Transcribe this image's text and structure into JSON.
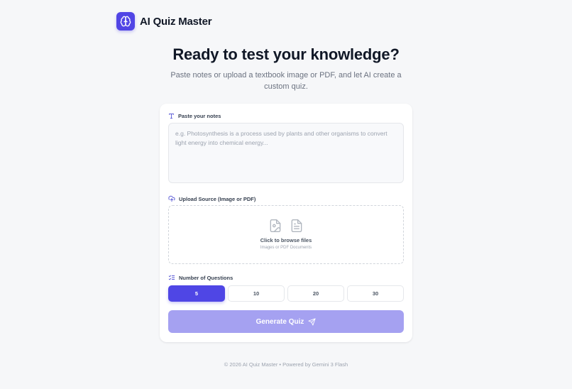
{
  "app": {
    "title": "AI Quiz Master",
    "brand_color": "#5145e5"
  },
  "hero": {
    "title": "Ready to test your knowledge?",
    "subtitle": "Paste notes or upload a textbook image or PDF, and let AI create a custom quiz."
  },
  "notes_section": {
    "label": "Paste your notes",
    "icon": "text-icon",
    "placeholder": "e.g. Photosynthesis is a process used by plants and other organisms to convert light energy into chemical energy...",
    "value": ""
  },
  "upload_section": {
    "label": "Upload Source (Image or PDF)",
    "icon": "cloud-upload-icon",
    "dropzone_title": "Click to browse files",
    "dropzone_subtitle": "Images or PDF Documents",
    "icons": [
      "image-file-icon",
      "document-file-icon"
    ]
  },
  "questions_section": {
    "label": "Number of Questions",
    "icon": "list-icon",
    "options": [
      "5",
      "10",
      "20",
      "30"
    ],
    "selected": "5",
    "accent_color": "#4f46e5"
  },
  "generate_button": {
    "label": "Generate Quiz",
    "icon": "send-icon",
    "color": "#a5a1f1"
  },
  "footer": {
    "text": "© 2026 AI Quiz Master • Powered by Gemini 3 Flash"
  }
}
